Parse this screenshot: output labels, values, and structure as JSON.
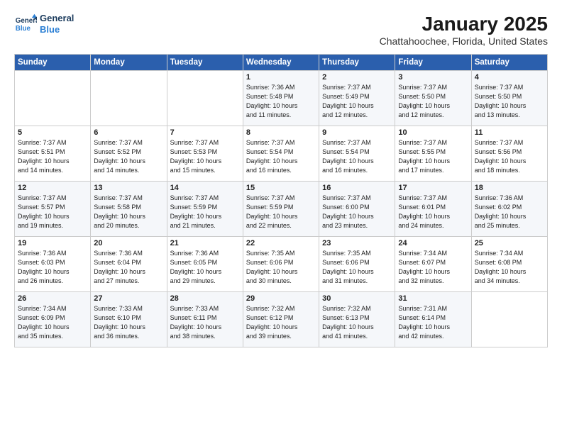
{
  "logo": {
    "line1": "General",
    "line2": "Blue"
  },
  "title": "January 2025",
  "subtitle": "Chattahoochee, Florida, United States",
  "days_header": [
    "Sunday",
    "Monday",
    "Tuesday",
    "Wednesday",
    "Thursday",
    "Friday",
    "Saturday"
  ],
  "weeks": [
    [
      {
        "num": "",
        "info": ""
      },
      {
        "num": "",
        "info": ""
      },
      {
        "num": "",
        "info": ""
      },
      {
        "num": "1",
        "info": "Sunrise: 7:36 AM\nSunset: 5:48 PM\nDaylight: 10 hours\nand 11 minutes."
      },
      {
        "num": "2",
        "info": "Sunrise: 7:37 AM\nSunset: 5:49 PM\nDaylight: 10 hours\nand 12 minutes."
      },
      {
        "num": "3",
        "info": "Sunrise: 7:37 AM\nSunset: 5:50 PM\nDaylight: 10 hours\nand 12 minutes."
      },
      {
        "num": "4",
        "info": "Sunrise: 7:37 AM\nSunset: 5:50 PM\nDaylight: 10 hours\nand 13 minutes."
      }
    ],
    [
      {
        "num": "5",
        "info": "Sunrise: 7:37 AM\nSunset: 5:51 PM\nDaylight: 10 hours\nand 14 minutes."
      },
      {
        "num": "6",
        "info": "Sunrise: 7:37 AM\nSunset: 5:52 PM\nDaylight: 10 hours\nand 14 minutes."
      },
      {
        "num": "7",
        "info": "Sunrise: 7:37 AM\nSunset: 5:53 PM\nDaylight: 10 hours\nand 15 minutes."
      },
      {
        "num": "8",
        "info": "Sunrise: 7:37 AM\nSunset: 5:54 PM\nDaylight: 10 hours\nand 16 minutes."
      },
      {
        "num": "9",
        "info": "Sunrise: 7:37 AM\nSunset: 5:54 PM\nDaylight: 10 hours\nand 16 minutes."
      },
      {
        "num": "10",
        "info": "Sunrise: 7:37 AM\nSunset: 5:55 PM\nDaylight: 10 hours\nand 17 minutes."
      },
      {
        "num": "11",
        "info": "Sunrise: 7:37 AM\nSunset: 5:56 PM\nDaylight: 10 hours\nand 18 minutes."
      }
    ],
    [
      {
        "num": "12",
        "info": "Sunrise: 7:37 AM\nSunset: 5:57 PM\nDaylight: 10 hours\nand 19 minutes."
      },
      {
        "num": "13",
        "info": "Sunrise: 7:37 AM\nSunset: 5:58 PM\nDaylight: 10 hours\nand 20 minutes."
      },
      {
        "num": "14",
        "info": "Sunrise: 7:37 AM\nSunset: 5:59 PM\nDaylight: 10 hours\nand 21 minutes."
      },
      {
        "num": "15",
        "info": "Sunrise: 7:37 AM\nSunset: 5:59 PM\nDaylight: 10 hours\nand 22 minutes."
      },
      {
        "num": "16",
        "info": "Sunrise: 7:37 AM\nSunset: 6:00 PM\nDaylight: 10 hours\nand 23 minutes."
      },
      {
        "num": "17",
        "info": "Sunrise: 7:37 AM\nSunset: 6:01 PM\nDaylight: 10 hours\nand 24 minutes."
      },
      {
        "num": "18",
        "info": "Sunrise: 7:36 AM\nSunset: 6:02 PM\nDaylight: 10 hours\nand 25 minutes."
      }
    ],
    [
      {
        "num": "19",
        "info": "Sunrise: 7:36 AM\nSunset: 6:03 PM\nDaylight: 10 hours\nand 26 minutes."
      },
      {
        "num": "20",
        "info": "Sunrise: 7:36 AM\nSunset: 6:04 PM\nDaylight: 10 hours\nand 27 minutes."
      },
      {
        "num": "21",
        "info": "Sunrise: 7:36 AM\nSunset: 6:05 PM\nDaylight: 10 hours\nand 29 minutes."
      },
      {
        "num": "22",
        "info": "Sunrise: 7:35 AM\nSunset: 6:06 PM\nDaylight: 10 hours\nand 30 minutes."
      },
      {
        "num": "23",
        "info": "Sunrise: 7:35 AM\nSunset: 6:06 PM\nDaylight: 10 hours\nand 31 minutes."
      },
      {
        "num": "24",
        "info": "Sunrise: 7:34 AM\nSunset: 6:07 PM\nDaylight: 10 hours\nand 32 minutes."
      },
      {
        "num": "25",
        "info": "Sunrise: 7:34 AM\nSunset: 6:08 PM\nDaylight: 10 hours\nand 34 minutes."
      }
    ],
    [
      {
        "num": "26",
        "info": "Sunrise: 7:34 AM\nSunset: 6:09 PM\nDaylight: 10 hours\nand 35 minutes."
      },
      {
        "num": "27",
        "info": "Sunrise: 7:33 AM\nSunset: 6:10 PM\nDaylight: 10 hours\nand 36 minutes."
      },
      {
        "num": "28",
        "info": "Sunrise: 7:33 AM\nSunset: 6:11 PM\nDaylight: 10 hours\nand 38 minutes."
      },
      {
        "num": "29",
        "info": "Sunrise: 7:32 AM\nSunset: 6:12 PM\nDaylight: 10 hours\nand 39 minutes."
      },
      {
        "num": "30",
        "info": "Sunrise: 7:32 AM\nSunset: 6:13 PM\nDaylight: 10 hours\nand 41 minutes."
      },
      {
        "num": "31",
        "info": "Sunrise: 7:31 AM\nSunset: 6:14 PM\nDaylight: 10 hours\nand 42 minutes."
      },
      {
        "num": "",
        "info": ""
      }
    ]
  ]
}
